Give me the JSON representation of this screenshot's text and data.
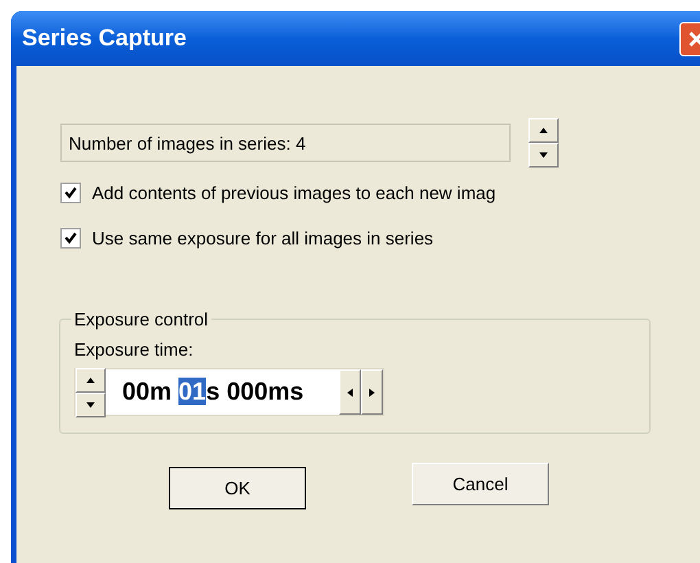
{
  "window": {
    "title": "Series Capture"
  },
  "images_field": {
    "value": "Number of images in series: 4"
  },
  "options": [
    {
      "label": "Add contents of previous images to each new imag",
      "checked": true
    },
    {
      "label": "Use same exposure for all images in series",
      "checked": true
    }
  ],
  "exposure_group": {
    "title": "Exposure control",
    "label": "Exposure time:",
    "segments": [
      {
        "text": "00m ",
        "selected": false
      },
      {
        "text": "01",
        "selected": true
      },
      {
        "text": "s 000ms",
        "selected": false
      }
    ]
  },
  "buttons": [
    {
      "label": "OK",
      "default": true
    },
    {
      "label": "Cancel",
      "default": false
    }
  ]
}
